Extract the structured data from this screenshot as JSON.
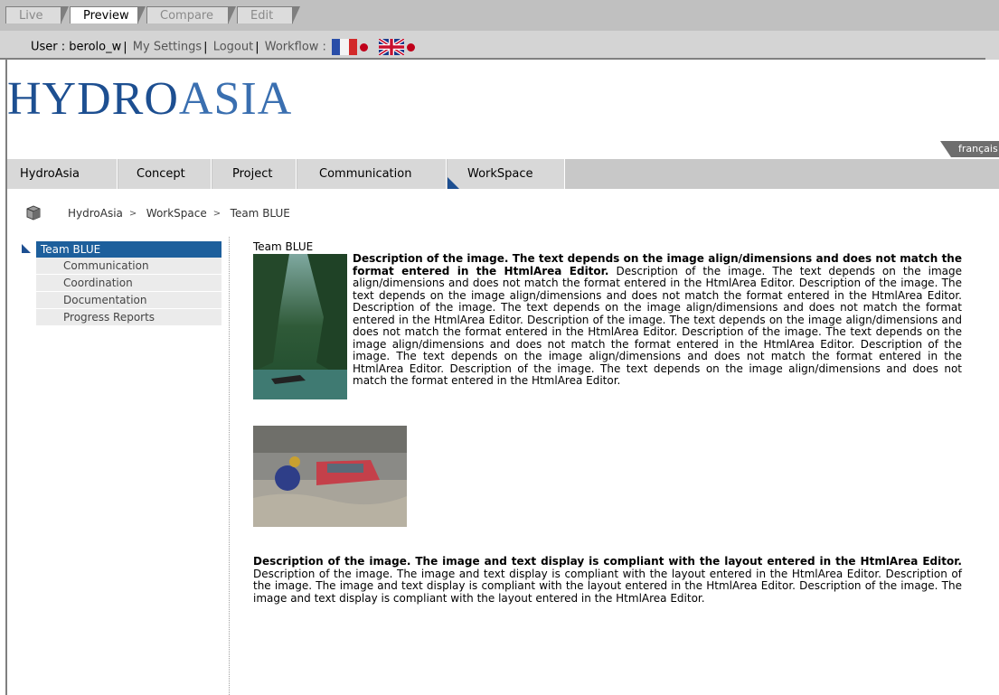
{
  "mode_tabs": [
    "Live",
    "Preview",
    "Compare",
    "Edit"
  ],
  "userbar": {
    "user_label": "User : berolo_w",
    "settings": "My Settings",
    "logout": "Logout",
    "workflow": "Workflow :"
  },
  "logo": {
    "part1": "HYDRO",
    "part2": "ASIA"
  },
  "language": "français",
  "nav_tabs": [
    "HydroAsia",
    "Concept",
    "Project",
    "Communication",
    "WorkSpace"
  ],
  "breadcrumb": [
    "HydroAsia",
    "WorkSpace",
    "Team BLUE"
  ],
  "sidebar": {
    "active": "Team BLUE",
    "items": [
      "Communication",
      "Coordination",
      "Documentation",
      "Progress Reports"
    ]
  },
  "content": {
    "title": "Team BLUE",
    "para1_bold": "Description of the image. The text depends on the image align/dimensions and does not match the format entered in the HtmlArea Editor.",
    "para1_rest": " Description of the image. The text depends on the image align/dimensions and does not match the format entered in the HtmlArea Editor. Description of the image. The text depends on the image align/dimensions and does not match the format entered in the HtmlArea Editor. Description of the image. The text depends on the image align/dimensions and does not match the format entered in the HtmlArea Editor. Description of the image. The text depends on the image align/dimensions and does not match the format entered in the HtmlArea Editor. Description of the image. The text depends on the image align/dimensions and does not match the format entered in the HtmlArea Editor. Description of the image. The text depends on the image align/dimensions and does not match the format entered in the HtmlArea Editor. Description of the image. The text depends on the image align/dimensions and does not match the format entered in the HtmlArea Editor.",
    "para2_bold": "Description of the image. The image and text display is compliant with the layout entered in the HtmlArea Editor.",
    "para2_rest": " Description of the image. The image and text display is compliant with the layout entered in the HtmlArea Editor. Description of the image. The image and text display is compliant with the layout entered in the HtmlArea Editor. Description of the image. The image and text display is compliant with the layout entered in the HtmlArea Editor."
  }
}
